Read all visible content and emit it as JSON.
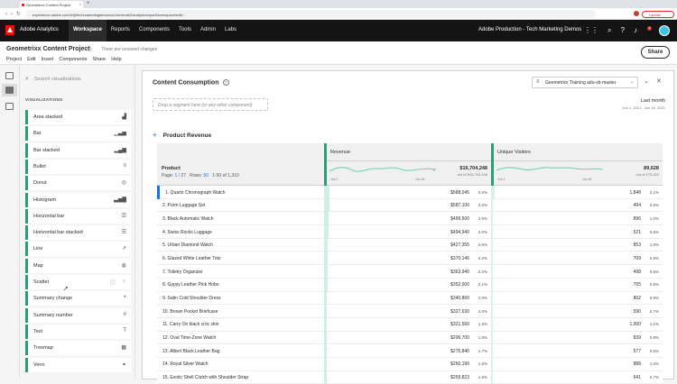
{
  "browser": {
    "tab_title": "Geometrixx Content Project",
    "url": "experience.adobe.com/#/@techmarketingdemos/so:techma62/analytics/spa/#/workspace/edit/...",
    "update_label": "Update"
  },
  "header": {
    "app_name": "Adobe Analytics",
    "nav": [
      "Workspace",
      "Reports",
      "Components",
      "Tools",
      "Admin",
      "Labs"
    ],
    "org": "Adobe Production - Tech Marketing Demos",
    "notifications": "3"
  },
  "project": {
    "title": "Geometrixx Content Project",
    "save_status": "There are unsaved changes",
    "menu": [
      "Project",
      "Edit",
      "Insert",
      "Components",
      "Share",
      "Help"
    ],
    "share_label": "Share"
  },
  "sidebar": {
    "search_placeholder": "Search visualizations",
    "heading": "VISUALIZATIONS",
    "items": [
      {
        "label": "Area stacked",
        "icon": "area-chart-icon"
      },
      {
        "label": "Bar",
        "icon": "bar-chart-icon"
      },
      {
        "label": "Bar stacked",
        "icon": "bar-stacked-icon"
      },
      {
        "label": "Bullet",
        "icon": "bullet-icon"
      },
      {
        "label": "Donut",
        "icon": "donut-icon"
      },
      {
        "label": "Histogram",
        "icon": "histogram-icon"
      },
      {
        "label": "Horizontal bar",
        "icon": "horizontal-bar-icon"
      },
      {
        "label": "Horizontal bar stacked",
        "icon": "horizontal-bar-stacked-icon"
      },
      {
        "label": "Line",
        "icon": "line-icon"
      },
      {
        "label": "Map",
        "icon": "map-icon"
      },
      {
        "label": "Scatter",
        "icon": "scatter-icon"
      },
      {
        "label": "Summary change",
        "icon": "summary-change-icon"
      },
      {
        "label": "Summary number",
        "icon": "summary-number-icon"
      },
      {
        "label": "Text",
        "icon": "text-icon"
      },
      {
        "label": "Treemap",
        "icon": "treemap-icon"
      },
      {
        "label": "Venn",
        "icon": "venn-icon"
      }
    ]
  },
  "panel": {
    "title": "Content Consumption",
    "segment_placeholder": "Drop a segment here (or any other component)",
    "report_suite": "Geometrixx Training adu-sb-master",
    "date_label": "Last month",
    "date_range": "Jun 1, 2021 - Jun 30, 2021",
    "freeform_title": "Product Revenue"
  },
  "table": {
    "dimension": "Product",
    "pager": {
      "page_label": "Page:",
      "page": "1",
      "of_pages": "/ 27",
      "rows_label": "Rows:",
      "rows": "50",
      "range": "1-50 of 1,310"
    },
    "columns": [
      {
        "name": "Revenue",
        "total": "$16,704,248",
        "total_of": "out of $16,704,248",
        "spark_start": "Jun 1",
        "spark_end": "Jun 30"
      },
      {
        "name": "Unique Visitors",
        "total": "89,628",
        "total_of": "out of 175,323",
        "spark_start": "Jun 1",
        "spark_end": "Jun 30"
      }
    ],
    "rows": [
      {
        "name": "1. Quartz Chronograph Watch",
        "rev": "$588,045",
        "rev_pct": "3.5%",
        "rev_frac": 0.035,
        "uv": "1,848",
        "uv_pct": "2.1%",
        "uv_frac": 0.021
      },
      {
        "name": "2. Purm Luggage Set",
        "rev": "$587,100",
        "rev_pct": "3.5%",
        "rev_frac": 0.035,
        "uv": "494",
        "uv_pct": "0.6%",
        "uv_frac": 0.006
      },
      {
        "name": "3. Black Automatic Watch",
        "rev": "$499,500",
        "rev_pct": "3.0%",
        "rev_frac": 0.03,
        "uv": "896",
        "uv_pct": "1.0%",
        "uv_frac": 0.01
      },
      {
        "name": "4. Swiss Rocks Luggage",
        "rev": "$494,940",
        "rev_pct": "3.0%",
        "rev_frac": 0.03,
        "uv": "521",
        "uv_pct": "0.6%",
        "uv_frac": 0.006
      },
      {
        "name": "5. Urban Diamond Watch",
        "rev": "$427,355",
        "rev_pct": "2.6%",
        "rev_frac": 0.026,
        "uv": "853",
        "uv_pct": "1.0%",
        "uv_frac": 0.01
      },
      {
        "name": "6. Glazed White Leather Tots",
        "rev": "$370,146",
        "rev_pct": "2.2%",
        "rev_frac": 0.022,
        "uv": "709",
        "uv_pct": "0.8%",
        "uv_frac": 0.008
      },
      {
        "name": "7. Toiletry Organizer",
        "rev": "$363,940",
        "rev_pct": "2.2%",
        "rev_frac": 0.022,
        "uv": "498",
        "uv_pct": "0.6%",
        "uv_frac": 0.006
      },
      {
        "name": "8. Gypsy Leather Pink Hobo",
        "rev": "$352,000",
        "rev_pct": "2.1%",
        "rev_frac": 0.021,
        "uv": "705",
        "uv_pct": "0.8%",
        "uv_frac": 0.008
      },
      {
        "name": "9. Satin Cold Shoulder Dress",
        "rev": "$340,860",
        "rev_pct": "2.0%",
        "rev_frac": 0.02,
        "uv": "802",
        "uv_pct": "0.9%",
        "uv_frac": 0.009
      },
      {
        "name": "10. Brown Pocket Briefcase",
        "rev": "$327,630",
        "rev_pct": "2.0%",
        "rev_frac": 0.02,
        "uv": "590",
        "uv_pct": "0.7%",
        "uv_frac": 0.007
      },
      {
        "name": "11. Carry On black croc skin",
        "rev": "$321,560",
        "rev_pct": "1.9%",
        "rev_frac": 0.019,
        "uv": "1,000",
        "uv_pct": "1.1%",
        "uv_frac": 0.011
      },
      {
        "name": "12. Oval Time-Zone Watch",
        "rev": "$296,700",
        "rev_pct": "1.8%",
        "rev_frac": 0.018,
        "uv": "839",
        "uv_pct": "0.9%",
        "uv_frac": 0.009
      },
      {
        "name": "13. Albert Black Leather Bag",
        "rev": "$275,840",
        "rev_pct": "1.7%",
        "rev_frac": 0.017,
        "uv": "577",
        "uv_pct": "0.6%",
        "uv_frac": 0.006
      },
      {
        "name": "14. Royal Silver Watch",
        "rev": "$260,190",
        "rev_pct": "1.6%",
        "rev_frac": 0.016,
        "uv": "888",
        "uv_pct": "1.0%",
        "uv_frac": 0.01
      },
      {
        "name": "15. Exotic Shell Clutch with Shoulder Strap",
        "rev": "$259,823",
        "rev_pct": "1.6%",
        "rev_frac": 0.016,
        "uv": "641",
        "uv_pct": "0.7%",
        "uv_frac": 0.007
      }
    ]
  }
}
